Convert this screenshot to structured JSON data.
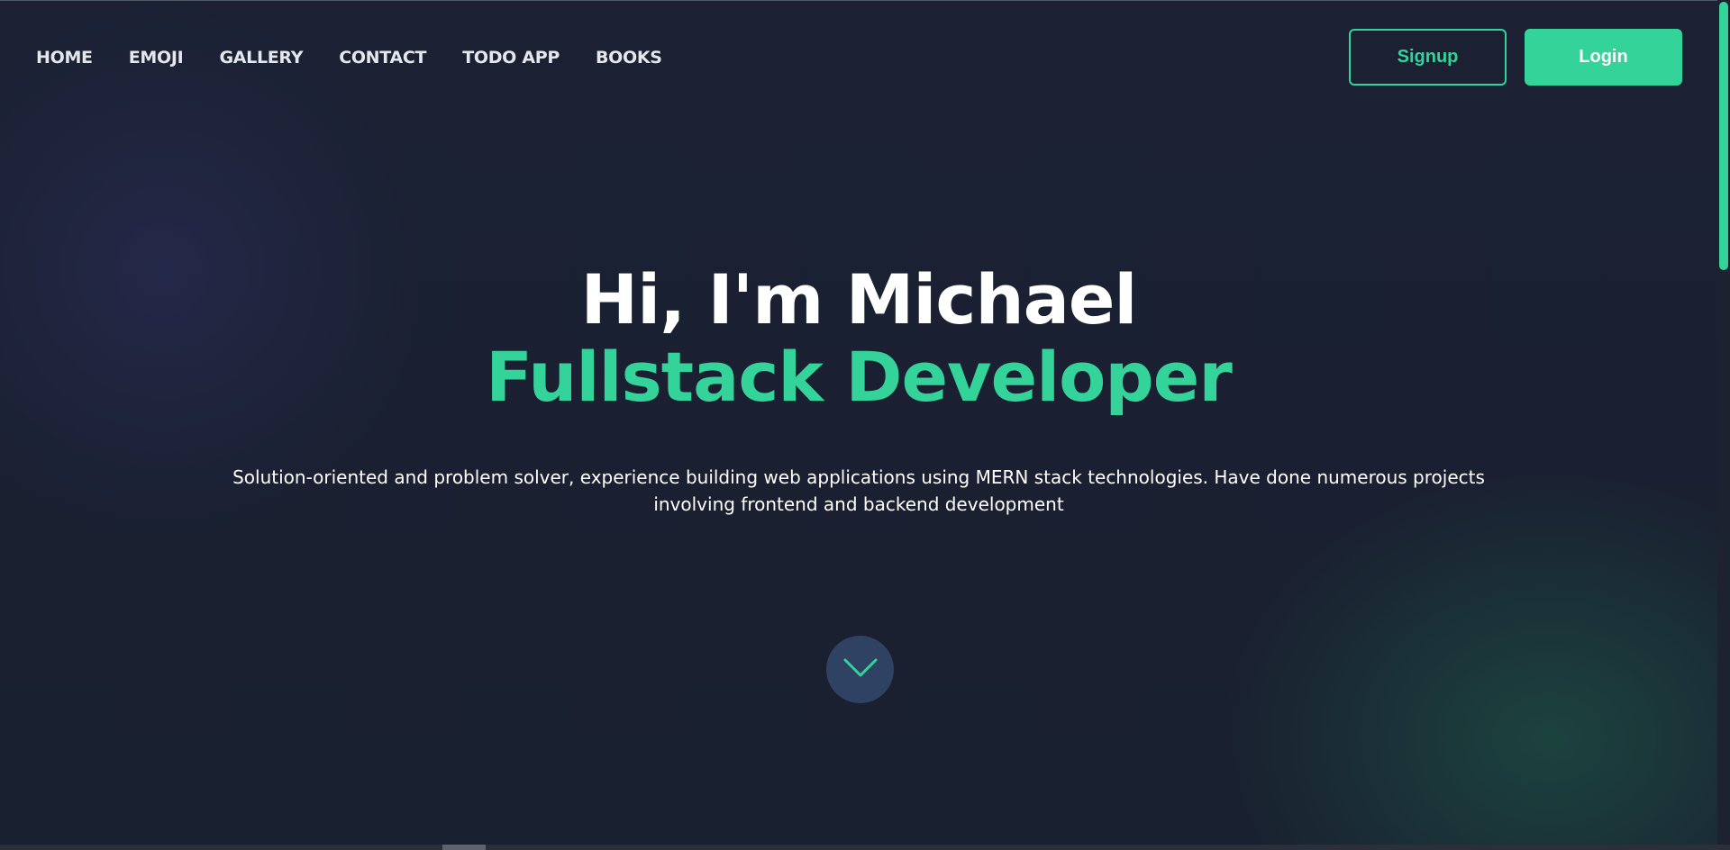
{
  "nav": {
    "items": [
      {
        "label": "HOME"
      },
      {
        "label": "EMOJI"
      },
      {
        "label": "GALLERY"
      },
      {
        "label": "CONTACT"
      },
      {
        "label": "TODO APP"
      },
      {
        "label": "BOOKS"
      }
    ]
  },
  "auth": {
    "signup_label": "Signup",
    "login_label": "Login"
  },
  "hero": {
    "greeting": "Hi, I'm Michael",
    "role": "Fullstack Developer",
    "description": "Solution-oriented and problem solver, experience building web applications using MERN stack technologies. Have done numerous projects involving frontend and backend development"
  },
  "scroll_button": {
    "icon": "chevron-down-icon"
  },
  "colors": {
    "accent": "#34d399",
    "background": "#1a2233",
    "scroll_button_bg": "#2f4263"
  }
}
